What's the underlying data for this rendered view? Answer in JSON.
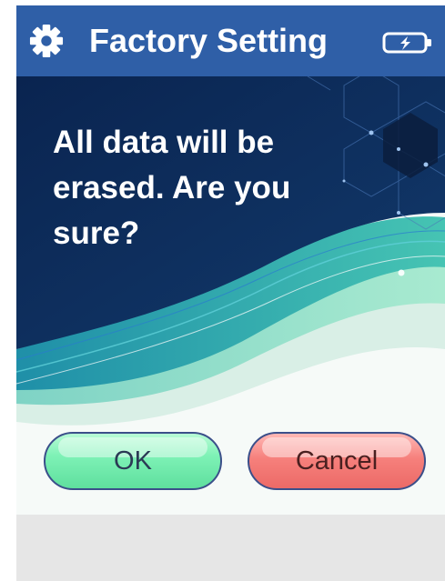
{
  "header": {
    "title": "Factory Setting",
    "left_icon": "gear-icon",
    "right_icon": "battery-charging-icon"
  },
  "dialog": {
    "message": "All data will be erased. Are you sure?"
  },
  "buttons": {
    "ok_label": "OK",
    "cancel_label": "Cancel"
  },
  "colors": {
    "header_bg": "#2f5fa7",
    "hero_dark": "#0c2a56",
    "ok_button": "#7ef2b6",
    "cancel_button": "#f6807c"
  }
}
